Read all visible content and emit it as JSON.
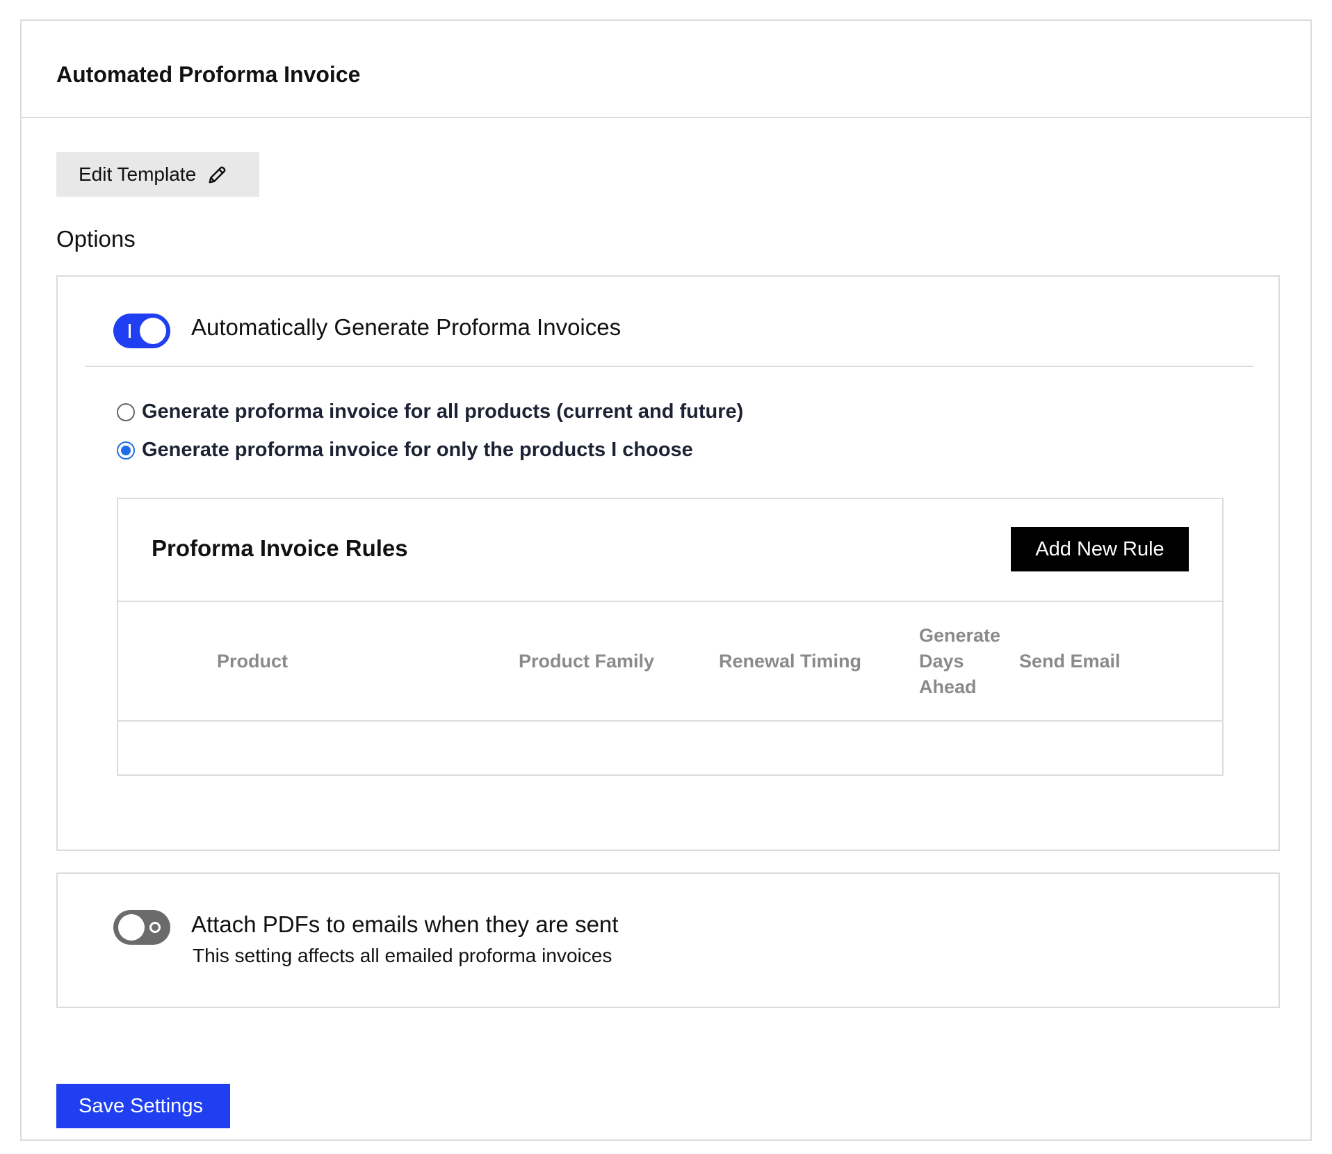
{
  "page": {
    "title": "Automated Proforma Invoice"
  },
  "toolbar": {
    "edit_template_label": "Edit Template"
  },
  "options": {
    "heading": "Options",
    "auto_generate": {
      "label": "Automatically Generate Proforma Invoices",
      "enabled": true
    },
    "radios": [
      {
        "label": "Generate proforma invoice for all products (current and future)",
        "checked": false
      },
      {
        "label": "Generate proforma invoice for only the products I choose",
        "checked": true
      }
    ]
  },
  "rules": {
    "title": "Proforma Invoice Rules",
    "add_button_label": "Add New Rule",
    "columns": [
      "Product",
      "Product Family",
      "Renewal Timing",
      "Generate Days Ahead",
      "Send Email"
    ],
    "rows": []
  },
  "pdf": {
    "label": "Attach PDFs to emails when they are sent",
    "sublabel": "This setting affects all emailed proforma invoices",
    "enabled": false
  },
  "footer": {
    "save_label": "Save Settings"
  },
  "colors": {
    "primary": "#1f3ff0",
    "radio_accent": "#1f6fe8",
    "toggle_off": "#6b6b6b",
    "border": "#dcdcdc",
    "column_header_text": "#8a8a8a"
  }
}
